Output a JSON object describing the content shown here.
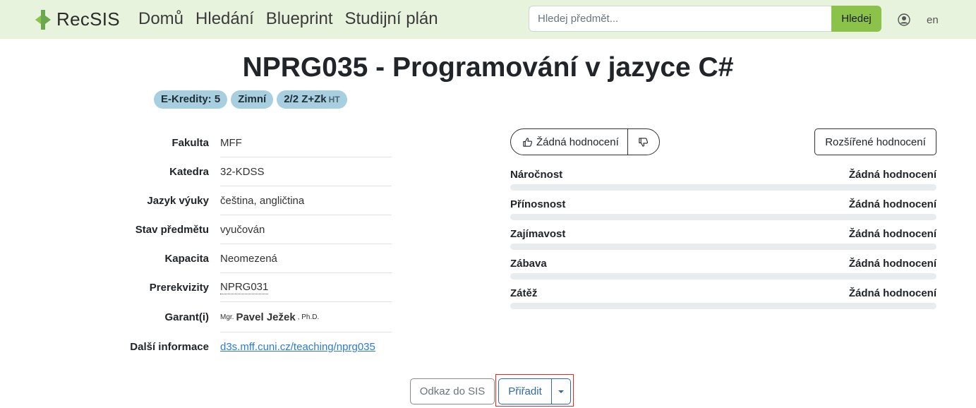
{
  "navbar": {
    "brand": "RecSIS",
    "links": [
      "Domů",
      "Hledání",
      "Blueprint",
      "Studijní plán"
    ],
    "search_placeholder": "Hledej předmět...",
    "search_button": "Hledej",
    "user_icon": "user-circle-icon",
    "language": "en"
  },
  "course": {
    "title": "NPRG035 - Programování v jazyce C#",
    "badges": {
      "credits": "E-Kredity: 5",
      "semester": "Zimní",
      "hours": "2/2 Z+Zk",
      "hours_suffix": "HT"
    }
  },
  "info": {
    "faculty": {
      "label": "Fakulta",
      "value": "MFF"
    },
    "department": {
      "label": "Katedra",
      "value": "32-KDSS"
    },
    "language": {
      "label": "Jazyk výuky",
      "value": "čeština, angličtina"
    },
    "state": {
      "label": "Stav předmětu",
      "value": "vyučován"
    },
    "capacity": {
      "label": "Kapacita",
      "value": "Neomezená"
    },
    "prerequisites": {
      "label": "Prerekvizity",
      "value": "NPRG031"
    },
    "guarantor": {
      "label": "Garant(i)",
      "title_before": "Mgr.",
      "name": "Pavel Ježek",
      "title_after": ", Ph.D."
    },
    "more": {
      "label": "Další informace",
      "value": "d3s.mff.cuni.cz/teaching/nprg035"
    }
  },
  "rating": {
    "like_label": "Žádná hodnocení",
    "extended_button": "Rozšířené hodnocení",
    "categories": [
      {
        "name": "Náročnost",
        "value": "Žádná hodnocení"
      },
      {
        "name": "Přínosnost",
        "value": "Žádná hodnocení"
      },
      {
        "name": "Zajímavost",
        "value": "Žádná hodnocení"
      },
      {
        "name": "Zábava",
        "value": "Žádná hodnocení"
      },
      {
        "name": "Zátěž",
        "value": "Žádná hodnocení"
      }
    ]
  },
  "actions": {
    "sis_link": "Odkaz do SIS",
    "assign": "Přiřadit"
  },
  "colors": {
    "navbar_bg": "#e8f3de",
    "accent_green": "#8bc34a",
    "badge_bg": "#a7cfe0",
    "link_blue": "#2b7bd6",
    "assign_blue": "#2f6aa6",
    "highlight_red": "#d32f2f"
  }
}
